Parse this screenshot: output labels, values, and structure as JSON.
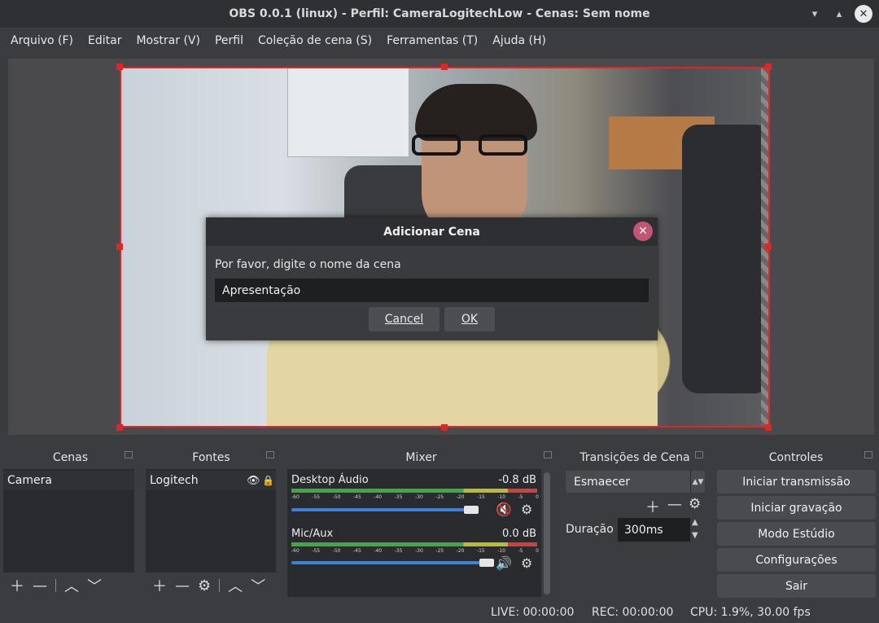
{
  "window": {
    "title": "OBS 0.0.1 (linux) - Perfil: CameraLogitechLow - Cenas: Sem nome",
    "minimize": "▾",
    "maximize": "▴",
    "close": "✕"
  },
  "menu": [
    "Arquivo (F)",
    "Editar",
    "Mostrar (V)",
    "Perfil",
    "Coleção de cena (S)",
    "Ferramentas (T)",
    "Ajuda (H)"
  ],
  "dialog": {
    "title": "Adicionar Cena",
    "prompt": "Por favor, digite o nome da cena",
    "value": "Apresentação",
    "cancel": "Cancel",
    "ok": "OK"
  },
  "docks": {
    "scenes": {
      "title": "Cenas",
      "items": [
        "Camera"
      ]
    },
    "sources": {
      "title": "Fontes",
      "items": [
        "Logitech"
      ]
    },
    "mixer": {
      "title": "Mixer",
      "scale": [
        "-60",
        "-55",
        "-50",
        "-45",
        "-40",
        "-35",
        "-30",
        "-25",
        "-20",
        "-15",
        "-10",
        "-5",
        "0"
      ],
      "tracks": [
        {
          "name": "Desktop Áudio",
          "level": "-0.8 dB",
          "muted": true,
          "volume": 0.92
        },
        {
          "name": "Mic/Aux",
          "level": "0.0 dB",
          "muted": false,
          "volume": 1.0
        }
      ]
    },
    "transitions": {
      "title": "Transições de Cena",
      "selected": "Esmaecer",
      "duration_label": "Duração",
      "duration": "300ms"
    },
    "controls": {
      "title": "Controles",
      "buttons": [
        "Iniciar transmissão",
        "Iniciar gravação",
        "Modo Estúdio",
        "Configurações",
        "Sair"
      ]
    }
  },
  "status": {
    "live": "LIVE: 00:00:00",
    "rec": "REC: 00:00:00",
    "cpu": "CPU: 1.9%, 30.00 fps"
  },
  "colors": {
    "selection": "#e32424",
    "slider": "#3c82d6",
    "mute": "#e03030",
    "dialog_close": "#c25572"
  }
}
